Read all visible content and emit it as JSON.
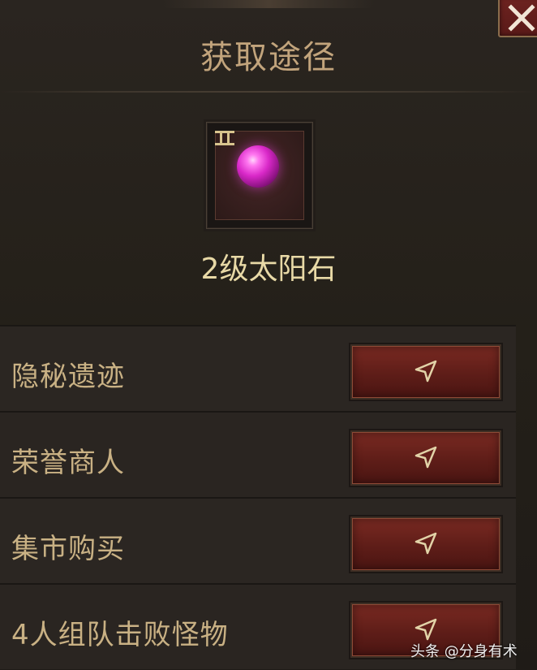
{
  "dialog": {
    "title": "获取途径",
    "close_icon": "close-icon"
  },
  "item": {
    "name": "2级太阳石",
    "tier_icon": "tier-icon",
    "gem_color": "#d928c8"
  },
  "sources": [
    {
      "label": "隐秘遗迹",
      "icon": "navigate-arrow-icon"
    },
    {
      "label": "荣誉商人",
      "icon": "navigate-arrow-icon"
    },
    {
      "label": "集市购买",
      "icon": "navigate-arrow-icon"
    },
    {
      "label": "4人组队击败怪物",
      "icon": "navigate-arrow-icon"
    }
  ],
  "watermark": "头条 @分身有术",
  "colors": {
    "title": "#c2a47c",
    "item_name": "#e8d9a6",
    "label": "#c9b184",
    "button": "#6e2320",
    "arrow": "#e2d3a8"
  }
}
